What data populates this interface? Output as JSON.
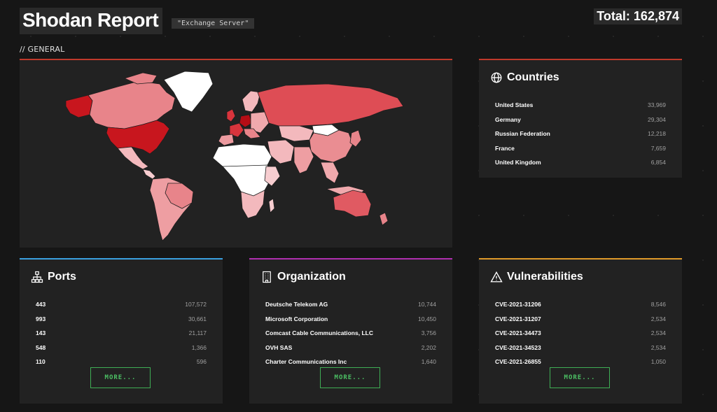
{
  "header": {
    "title": "Shodan Report",
    "query": "\"Exchange Server\"",
    "total_label": "Total: 162,874"
  },
  "section": {
    "label": "// GENERAL"
  },
  "colors": {
    "countries_accent": "#c0392b",
    "ports_accent": "#3aa0e0",
    "organization_accent": "#b02fb0",
    "vulnerabilities_accent": "#e09a2a",
    "more_button": "#4cc064"
  },
  "map": {
    "icon": "world-map"
  },
  "countries": {
    "title": "Countries",
    "icon": "globe-icon",
    "items": [
      {
        "name": "United States",
        "count": "33,969"
      },
      {
        "name": "Germany",
        "count": "29,304"
      },
      {
        "name": "Russian Federation",
        "count": "12,218"
      },
      {
        "name": "France",
        "count": "7,659"
      },
      {
        "name": "United Kingdom",
        "count": "6,854"
      }
    ]
  },
  "ports": {
    "title": "Ports",
    "icon": "network-icon",
    "items": [
      {
        "name": "443",
        "count": "107,572"
      },
      {
        "name": "993",
        "count": "30,661"
      },
      {
        "name": "143",
        "count": "21,117"
      },
      {
        "name": "548",
        "count": "1,366"
      },
      {
        "name": "110",
        "count": "596"
      }
    ],
    "more_label": "MORE..."
  },
  "organization": {
    "title": "Organization",
    "icon": "building-icon",
    "items": [
      {
        "name": "Deutsche Telekom AG",
        "count": "10,744"
      },
      {
        "name": "Microsoft Corporation",
        "count": "10,450"
      },
      {
        "name": "Comcast Cable Communications, LLC",
        "count": "3,756"
      },
      {
        "name": "OVH SAS",
        "count": "2,202"
      },
      {
        "name": "Charter Communications Inc",
        "count": "1,640"
      }
    ],
    "more_label": "MORE..."
  },
  "vulnerabilities": {
    "title": "Vulnerabilities",
    "icon": "warning-icon",
    "items": [
      {
        "name": "CVE-2021-31206",
        "count": "8,546"
      },
      {
        "name": "CVE-2021-31207",
        "count": "2,534"
      },
      {
        "name": "CVE-2021-34473",
        "count": "2,534"
      },
      {
        "name": "CVE-2021-34523",
        "count": "2,534"
      },
      {
        "name": "CVE-2021-26855",
        "count": "1,050"
      }
    ],
    "more_label": "MORE..."
  }
}
